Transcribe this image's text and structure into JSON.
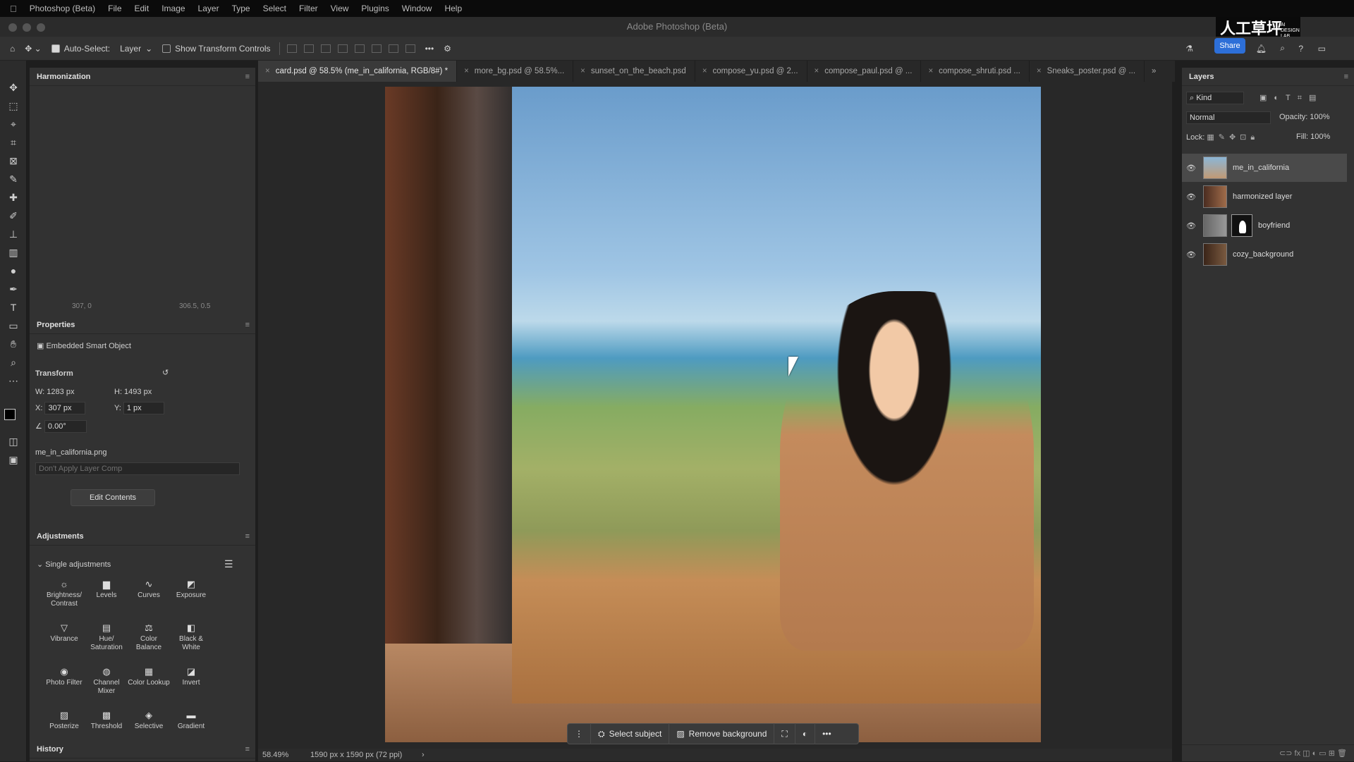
{
  "menubar": {
    "items": [
      "Photoshop (Beta)",
      "File",
      "Edit",
      "Image",
      "Layer",
      "Type",
      "Select",
      "Filter",
      "View",
      "Plugins",
      "Window",
      "Help"
    ]
  },
  "window": {
    "title": "Adobe Photoshop (Beta)"
  },
  "options": {
    "auto_select_label": "Auto-Select:",
    "auto_select_value": "Layer",
    "show_transform_label": "Show Transform Controls"
  },
  "logo": {
    "text": "人工草坪",
    "sub": "AI DESIGN LAB"
  },
  "share": {
    "label": "Share"
  },
  "tabs": [
    {
      "label": "card.psd @ 58.5% (me_in_california, RGB/8#) *"
    },
    {
      "label": "more_bg.psd @ 58.5%..."
    },
    {
      "label": "sunset_on_the_beach.psd"
    },
    {
      "label": "compose_yu.psd @ 2..."
    },
    {
      "label": "compose_paul.psd @ ..."
    },
    {
      "label": "compose_shruti.psd ..."
    },
    {
      "label": "Sneaks_poster.psd @ ..."
    }
  ],
  "harmonization": {
    "title": "Harmonization",
    "coord1": "307, 0",
    "coord2": "306.5, 0.5"
  },
  "properties": {
    "title": "Properties",
    "type": "Embedded Smart Object",
    "transform_label": "Transform",
    "w": "W:  1283 px",
    "h": "H:  1493 px",
    "x_label": "X:",
    "x_value": "307 px",
    "y_label": "Y:",
    "y_value": "1 px",
    "angle": "0.00°",
    "filename": "me_in_california.png",
    "layer_comp_placeholder": "Don't Apply Layer Comp",
    "edit_button": "Edit Contents"
  },
  "adjustments": {
    "title": "Adjustments",
    "section": "Single adjustments",
    "items": [
      {
        "label": "Brightness/ Contrast",
        "icon": "brightness-icon"
      },
      {
        "label": "Levels",
        "icon": "levels-icon"
      },
      {
        "label": "Curves",
        "icon": "curves-icon"
      },
      {
        "label": "Exposure",
        "icon": "exposure-icon"
      },
      {
        "label": "Vibrance",
        "icon": "vibrance-icon"
      },
      {
        "label": "Hue/ Saturation",
        "icon": "hue-icon"
      },
      {
        "label": "Color Balance",
        "icon": "balance-icon"
      },
      {
        "label": "Black & White",
        "icon": "bw-icon"
      },
      {
        "label": "Photo Filter",
        "icon": "photo-filter-icon"
      },
      {
        "label": "Channel Mixer",
        "icon": "mixer-icon"
      },
      {
        "label": "Color Lookup",
        "icon": "lookup-icon"
      },
      {
        "label": "Invert",
        "icon": "invert-icon"
      },
      {
        "label": "Posterize",
        "icon": "posterize-icon"
      },
      {
        "label": "Threshold",
        "icon": "threshold-icon"
      },
      {
        "label": "Selective",
        "icon": "selective-icon"
      },
      {
        "label": "Gradient",
        "icon": "gradient-icon"
      }
    ]
  },
  "history": {
    "title": "History"
  },
  "context_bar": {
    "select_subject": "Select subject",
    "remove_background": "Remove background"
  },
  "status": {
    "zoom": "58.49%",
    "doc_size": "1590 px x 1590 px (72 ppi)"
  },
  "layers": {
    "title": "Layers",
    "filter": "Kind",
    "blend": "Normal",
    "opacity_label": "Opacity:",
    "opacity": "100%",
    "lock_label": "Lock:",
    "fill_label": "Fill:",
    "fill": "100%",
    "items": [
      {
        "name": "me_in_california",
        "selected": true
      },
      {
        "name": "harmonized layer",
        "selected": false
      },
      {
        "name": "boyfriend",
        "selected": false
      },
      {
        "name": "cozy_background",
        "selected": false
      }
    ]
  }
}
